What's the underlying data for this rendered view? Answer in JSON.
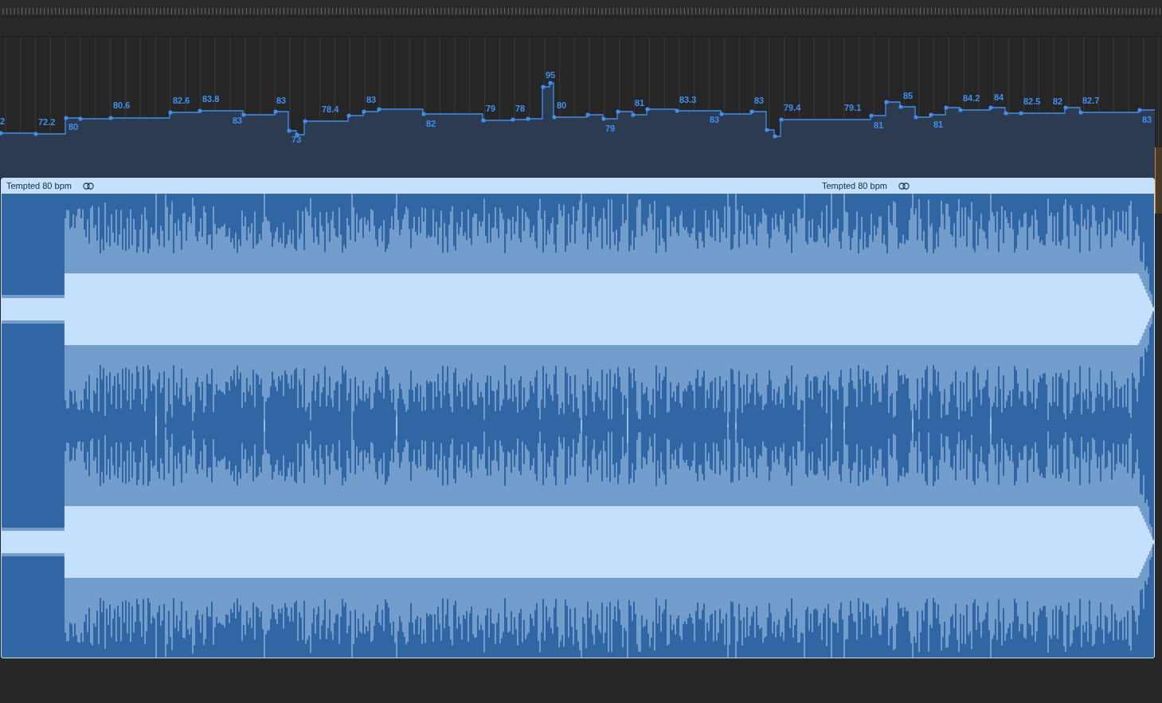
{
  "tempo_track": {
    "tempo_labels": [
      "2",
      "72.2",
      "80",
      "80.6",
      "82.6",
      "83.8",
      "83",
      "83",
      "73",
      "78.4",
      "83",
      "82",
      "79",
      "78",
      "95",
      "80",
      "79",
      "81",
      "83.3",
      "83",
      "83",
      "79.4",
      "79.1",
      "81",
      "85",
      "81",
      "84.2",
      "84",
      "82.5",
      "82",
      "82.7",
      "83"
    ]
  },
  "audio_region": {
    "labels": [
      "Tempted 80 bpm",
      "Tempted 80 bpm"
    ]
  }
}
